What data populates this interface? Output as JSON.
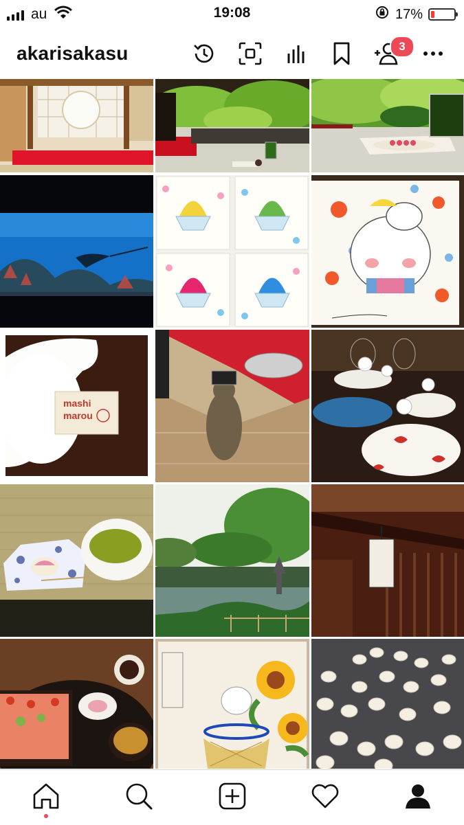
{
  "status_bar": {
    "carrier": "au",
    "time": "19:08",
    "battery_percent": "17%",
    "battery_level": 0.17,
    "battery_color": "#ff3b30"
  },
  "header": {
    "username": "akarisakasu",
    "notification_count": "3",
    "badge_color": "#ed4956",
    "icons": [
      "archive-history-icon",
      "qr-scan-icon",
      "insights-icon",
      "saved-bookmark-icon",
      "discover-people-icon",
      "more-options-icon"
    ]
  },
  "grid": {
    "posts": [
      "tatami-room-round-window",
      "garden-view-with-matcha",
      "matcha-by-garden",
      "aquarium-manta-ray",
      "shaved-ice-illustrations",
      "cat-kimono-illustration",
      "cat-plush-mashi-marou-tag",
      "penguin-on-glass-table",
      "glass-cat-figurines",
      "matcha-and-wagashi",
      "kenrokuen-garden-pond",
      "wooden-teahouse-lantern",
      "seafood-bowl-set",
      "glass-cat-sunflower-painting",
      "clay-cat-figures"
    ],
    "tag_text": [
      "mashi",
      "marou"
    ]
  },
  "bottom_nav": {
    "items": [
      "home-icon",
      "search-icon",
      "new-post-icon",
      "activity-heart-icon",
      "profile-icon"
    ],
    "active": "home-icon"
  }
}
